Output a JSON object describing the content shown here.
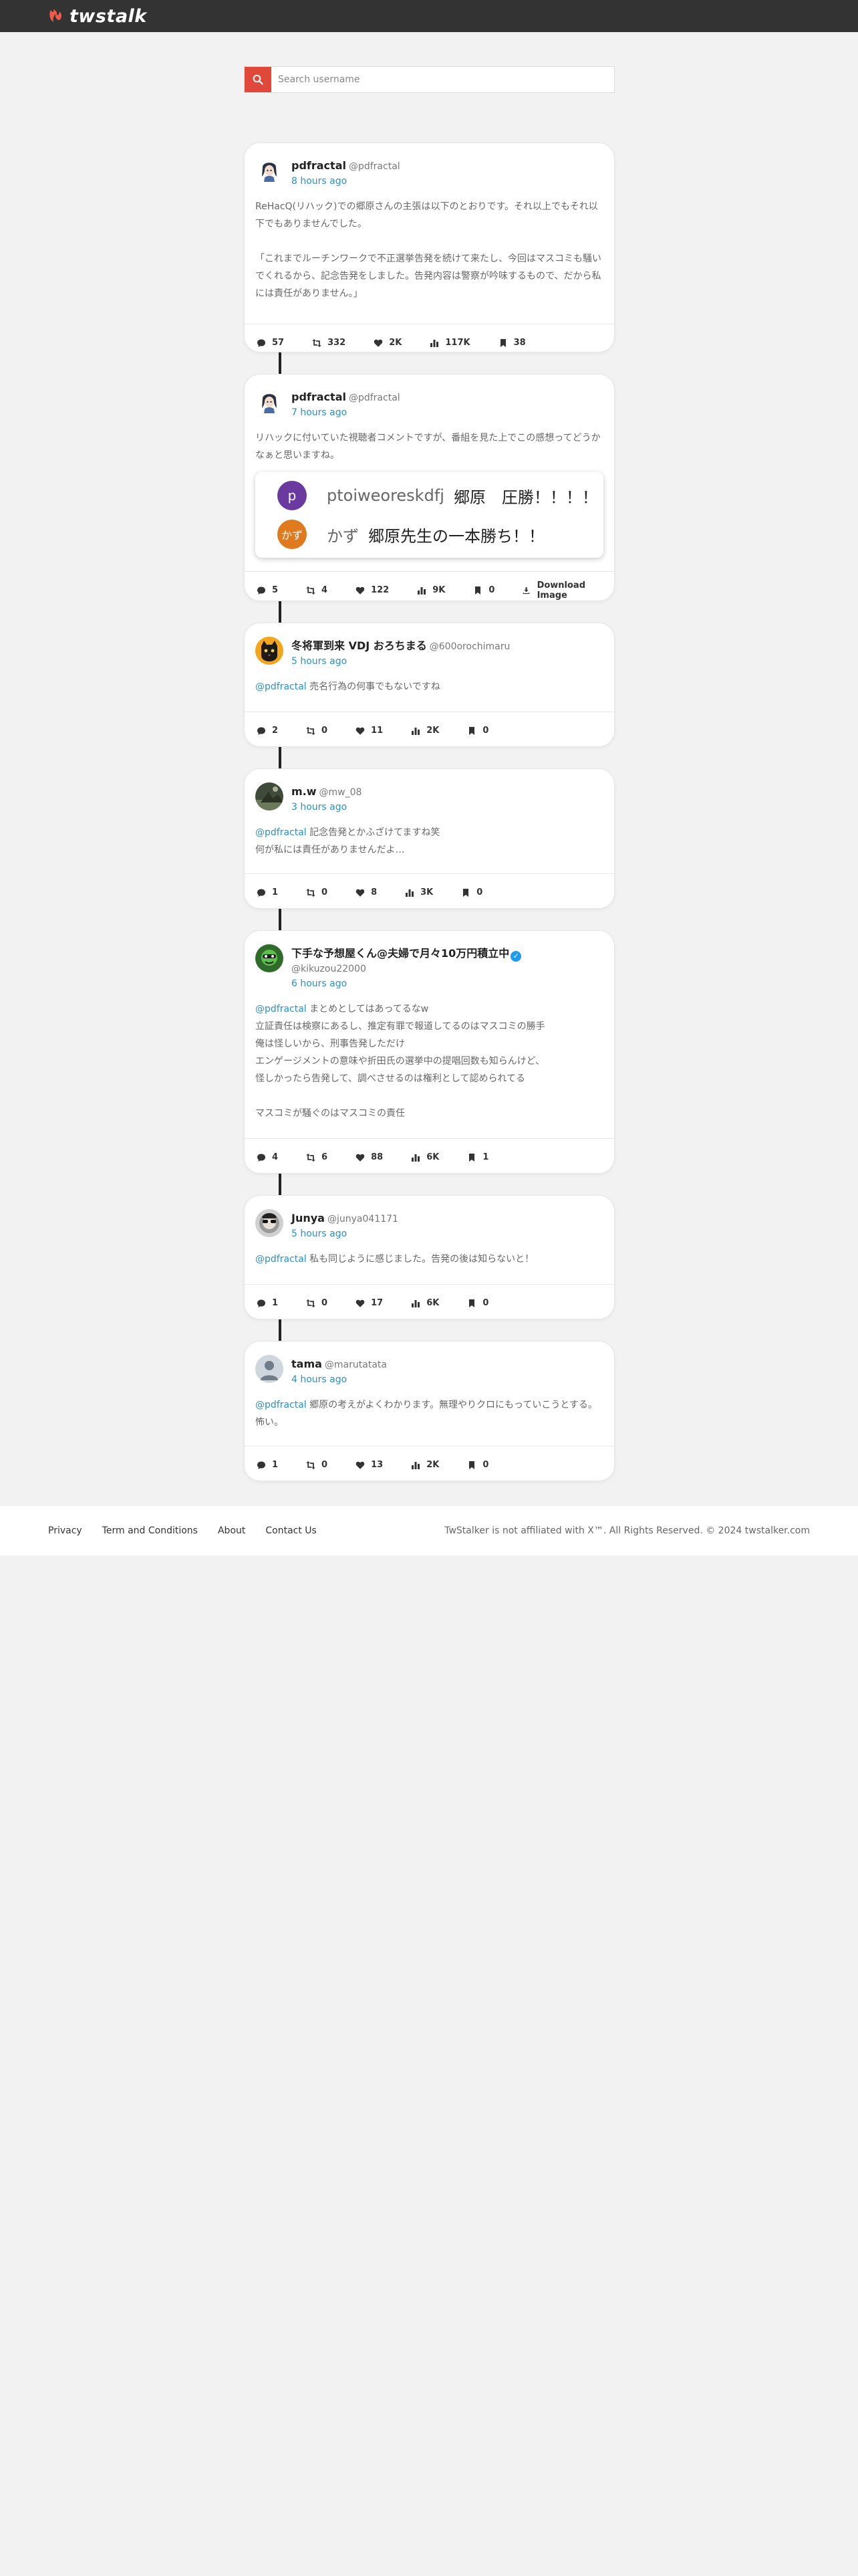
{
  "header": {
    "logo_text": "twstalk",
    "brand_color": "#ef5b47"
  },
  "search": {
    "placeholder": "Search username"
  },
  "posts": [
    {
      "display_name": "pdfractal",
      "handle": "@pdfractal",
      "time": "8 hours ago",
      "avatar": "anime-girl-avatar",
      "mention": "",
      "text": "ReHacQ(リハック)での郷原さんの主張は以下のとおりです。それ以上でもそれ以下でもありませんでした。\n\n「これまでルーチンワークで不正選挙告発を続けて来たし、今回はマスコミも騒いでくれるから、記念告発をしました。告発内容は警察が吟味するもので、だから私には責任がありません。」",
      "replies": "57",
      "retweets": "332",
      "likes": "2K",
      "views": "117K",
      "bookmarks": "38"
    },
    {
      "display_name": "pdfractal",
      "handle": "@pdfractal",
      "time": "7 hours ago",
      "avatar": "anime-girl-avatar",
      "mention": "",
      "text": "リハックに付いていた視聴者コメントですが、番組を見た上でこの感想ってどうかなぁと思いますね。",
      "embed": [
        {
          "initial": "p",
          "color": "#6a3aa0",
          "name": "ptoiweoreskdfj",
          "text": "郷原　圧勝！！！！"
        },
        {
          "initial": "かず",
          "color": "#e07a1f",
          "name": "かず",
          "text": "郷原先生の一本勝ち！！"
        }
      ],
      "replies": "5",
      "retweets": "4",
      "likes": "122",
      "views": "9K",
      "bookmarks": "0",
      "download_label": "Download Image"
    },
    {
      "display_name": "冬将軍到来 VDJ おろちまる",
      "handle": "@600orochimaru",
      "time": "5 hours ago",
      "avatar": "cat-avatar",
      "mention": "@pdfractal",
      "text": " 売名行為の何事でもないですね",
      "replies": "2",
      "retweets": "0",
      "likes": "11",
      "views": "2K",
      "bookmarks": "0"
    },
    {
      "display_name": "m.w",
      "handle": "@mw_08",
      "time": "3 hours ago",
      "avatar": "photo-avatar",
      "mention": "@pdfractal",
      "text": " 記念告発とかふざけてますね笑\n何が私には責任がありませんだよ…",
      "replies": "1",
      "retweets": "0",
      "likes": "8",
      "views": "3K",
      "bookmarks": "0"
    },
    {
      "display_name": "下手な予想屋くん@夫婦で月々10万円積立中",
      "handle": "@kikuzou22000",
      "time": "6 hours ago",
      "avatar": "green-character-avatar",
      "verified": true,
      "mention": "@pdfractal",
      "text": " まとめとしてはあってるなw\n立証責任は検察にあるし、推定有罪で報道してるのはマスコミの勝手\n俺は怪しいから、刑事告発しただけ\nエンゲージメントの意味や折田氏の選挙中の提唱回数も知らんけど、\n怪しかったら告発して、調べさせるのは権利として認められてる\n\nマスコミが騒ぐのはマスコミの責任",
      "replies": "4",
      "retweets": "6",
      "likes": "88",
      "views": "6K",
      "bookmarks": "1"
    },
    {
      "display_name": "Junya",
      "handle": "@junya041171",
      "time": "5 hours ago",
      "avatar": "sunglasses-avatar",
      "mention": "@pdfractal",
      "text": " 私も同じように感じました。告発の後は知らないと！",
      "replies": "1",
      "retweets": "0",
      "likes": "17",
      "views": "6K",
      "bookmarks": "0"
    },
    {
      "display_name": "tama",
      "handle": "@marutatata",
      "time": "4 hours ago",
      "avatar": "default-avatar",
      "mention": "@pdfractal",
      "text": " 郷原の考えがよくわかります。無理やりクロにもっていこうとする。怖い。",
      "replies": "1",
      "retweets": "0",
      "likes": "13",
      "views": "2K",
      "bookmarks": "0"
    }
  ],
  "footer": {
    "links": [
      "Privacy",
      "Term and Conditions",
      "About",
      "Contact Us"
    ],
    "copyright": "TwStalker is not affiliated with X™. All Rights Reserved. © 2024 twstalker.com"
  }
}
